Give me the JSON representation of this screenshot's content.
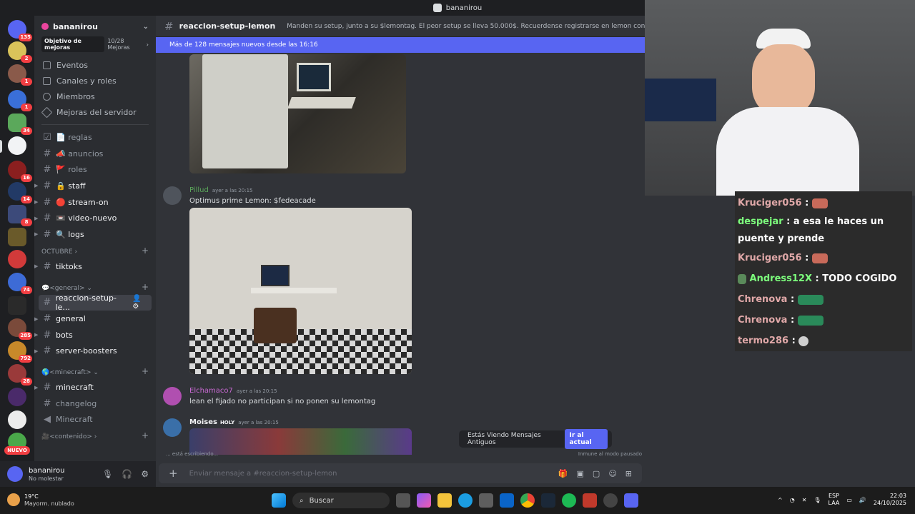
{
  "window": {
    "title": "bananirou"
  },
  "rail": {
    "badges": [
      "135",
      "2",
      "1",
      "1",
      "34",
      "16",
      "14",
      "8",
      "74",
      "285",
      "792",
      "28"
    ],
    "new_label": "NUEVO"
  },
  "server": {
    "name": "bananirou",
    "boost_goal": "Objetivo de mejoras",
    "boost_count": "10/28 Mejoras"
  },
  "nav": [
    "Eventos",
    "Canales y roles",
    "Miembros",
    "Mejoras del servidor"
  ],
  "channels_top": [
    {
      "label": "📄 reglas"
    },
    {
      "label": "📣 anuncios"
    },
    {
      "label": "🚩 roles"
    },
    {
      "label": "🔒 staff"
    },
    {
      "label": "🔴 stream-on"
    },
    {
      "label": "📼 video-nuevo"
    },
    {
      "label": "🔍 logs"
    }
  ],
  "cat_octubre": "OCTUBRE",
  "ch_tiktoks": "tiktoks",
  "cat_general": "💬<general>",
  "channels_general": [
    "reaccion-setup-le...",
    "general",
    "bots",
    "server-boosters"
  ],
  "cat_minecraft": "🌎<minecraft>",
  "channels_minecraft": [
    "minecraft",
    "changelog",
    "Minecraft"
  ],
  "cat_contenido": "🎥<contenido>",
  "user": {
    "name": "bananirou",
    "status": "No molestar"
  },
  "chat": {
    "channel": "reaccion-setup-lemon",
    "topic": "Manden su setup, junto a su $lemontag. El peor setup se lleva 50.000$. Recuerdense registrarse en lemon con codigo #bananirou.",
    "new_messages": "Más de 128 mensajes nuevos desde las 16:16",
    "messages": [
      {
        "author": "Pillud",
        "time": "ayer a las 20:15",
        "text": "Optimus prime Lemon: $fedeacade"
      },
      {
        "author": "Elchamaco7",
        "time": "ayer a las 20:15",
        "text": "lean el fijado no participan si no ponen su lemontag"
      },
      {
        "author": "Moises",
        "tag": "HOLY",
        "time": "ayer a las 20:15",
        "text": ""
      }
    ],
    "old_messages": "Estás Viendo Mensajes Antiguos",
    "go_current": "Ir al actual",
    "input_placeholder": "Enviar mensaje a #reaccion-setup-lemon",
    "immune": "Inmune al modo pausado",
    "typing": "... está escribiendo..."
  },
  "stream_chat": [
    {
      "user": "Kruciger056",
      "text": ""
    },
    {
      "user": "despejar",
      "text": "a esa le haces un puente y prende",
      "color": "#7cfc7c"
    },
    {
      "user": "Kruciger056",
      "text": ""
    },
    {
      "user": "Andress12X",
      "text": "TODO COGIDO",
      "color": "#7cfc7c"
    },
    {
      "user": "Chrenova",
      "text": ""
    },
    {
      "user": "Chrenova",
      "text": ""
    },
    {
      "user": "termo286",
      "text": ""
    }
  ],
  "taskbar": {
    "temp": "19°C",
    "weather": "Mayorm. nublado",
    "search": "Buscar",
    "lang1": "ESP",
    "lang2": "LAA",
    "time": "22:03",
    "date": "24/10/2025"
  }
}
